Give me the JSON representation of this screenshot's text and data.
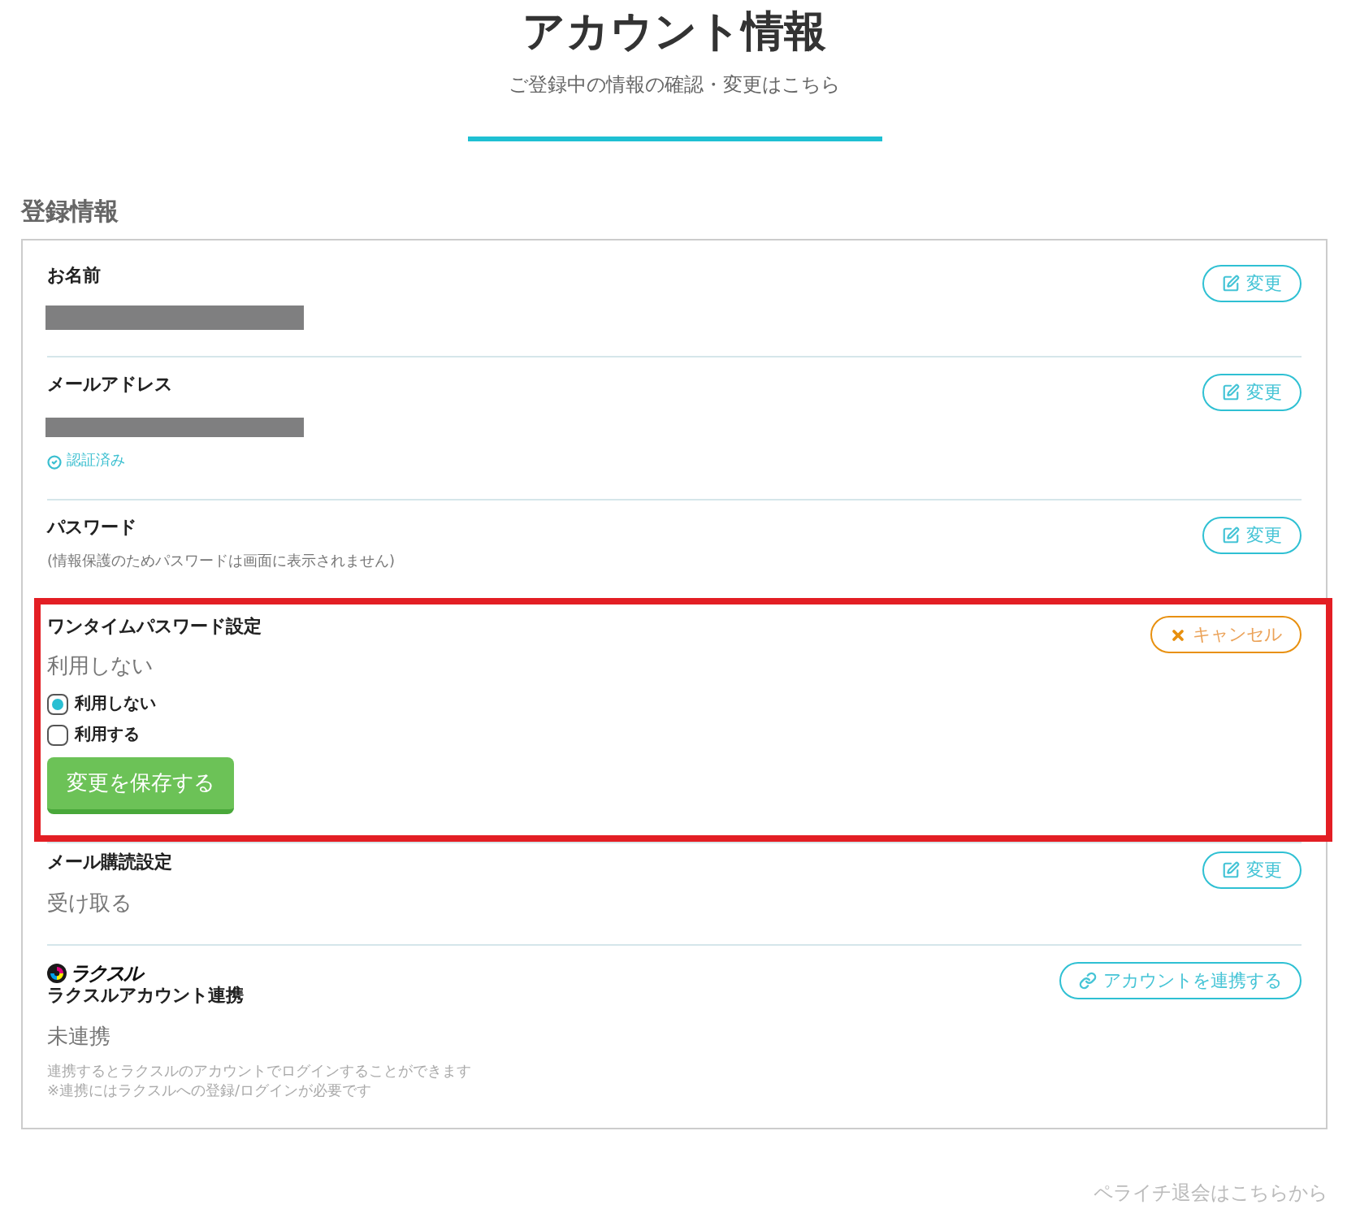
{
  "header": {
    "title": "アカウント情報",
    "subtitle": "ご登録中の情報の確認・変更はこちら"
  },
  "section": {
    "heading": "登録情報"
  },
  "rows": [
    {
      "kind": "display",
      "label": "お名前",
      "redacted": true,
      "button": {
        "kind": "edit",
        "label": "変更"
      }
    },
    {
      "kind": "display",
      "label": "メールアドレス",
      "redacted": true,
      "verified": "認証済み",
      "button": {
        "kind": "edit",
        "label": "変更"
      }
    },
    {
      "kind": "display",
      "label": "パスワード",
      "note": "(情報保護のためパスワードは画面に表示されません)",
      "button": {
        "kind": "edit",
        "label": "変更"
      }
    },
    {
      "kind": "radio-form",
      "label": "ワンタイムパスワード設定",
      "highlighted": true,
      "value": "利用しない",
      "options": [
        {
          "label": "利用しない",
          "selected": true
        },
        {
          "label": "利用する",
          "selected": false
        }
      ],
      "submit": "変更を保存する",
      "button": {
        "kind": "cancel",
        "label": "キャンセル"
      }
    },
    {
      "kind": "display",
      "label": "メール購読設定",
      "value": "受け取る",
      "button": {
        "kind": "edit",
        "label": "変更"
      }
    },
    {
      "kind": "connect",
      "logo": "ラクスル",
      "label": "ラクスルアカウント連携",
      "value": "未連携",
      "notes": [
        "連携するとラクスルのアカウントでログインすることができます",
        "※連携にはラクスルへの登録/ログインが必要です"
      ],
      "button": {
        "kind": "link",
        "label": "アカウントを連携する"
      }
    }
  ],
  "footer_link": "ペライチ退会はこちらから"
}
